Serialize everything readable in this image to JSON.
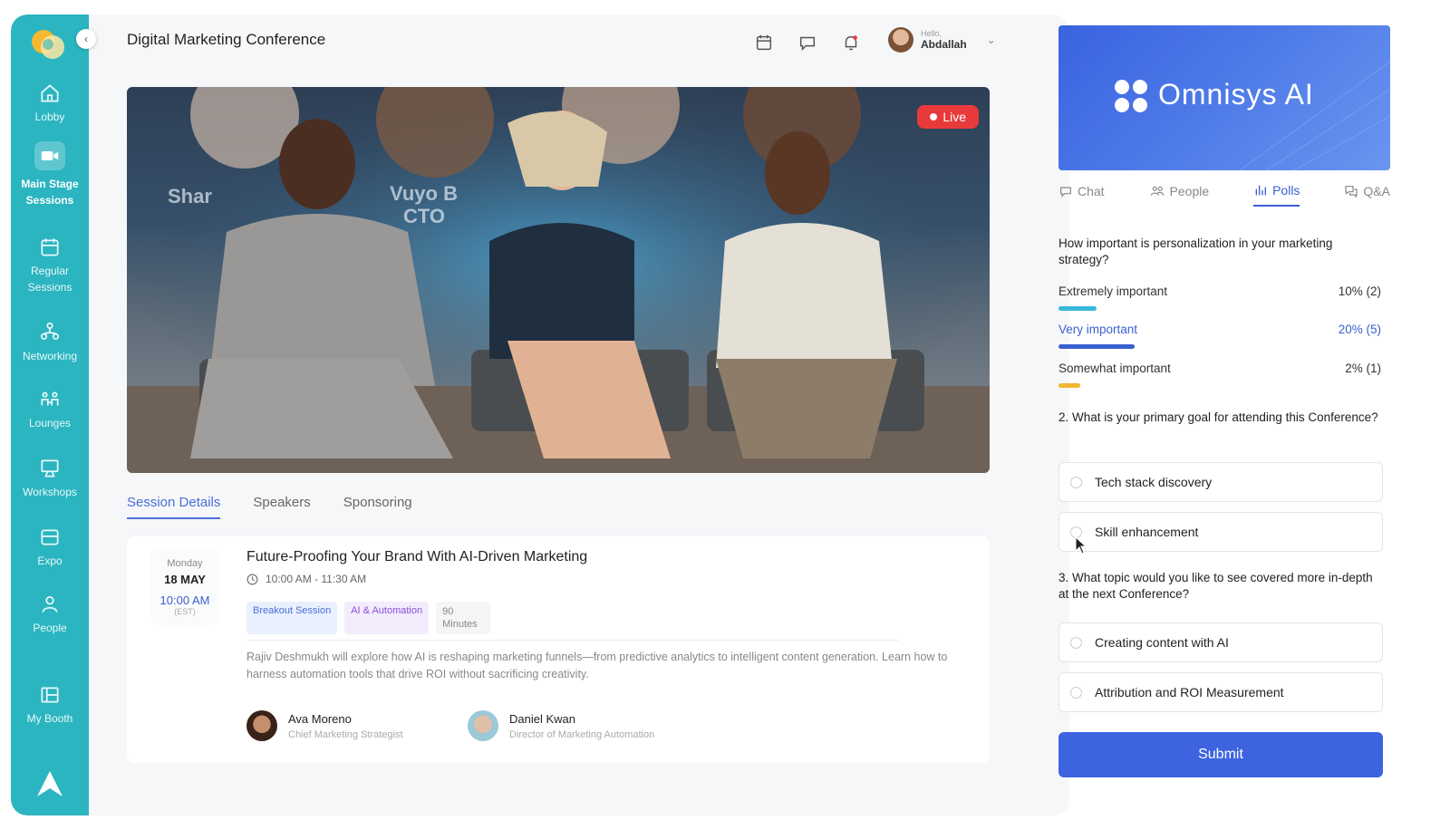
{
  "header": {
    "title": "Digital Marketing Conference",
    "user_greeting": "Hello,",
    "user_name": "Abdallah"
  },
  "sidebar": {
    "items": [
      {
        "label": "Lobby",
        "icon": "home-icon"
      },
      {
        "label": "Main Stage Sessions",
        "icon": "video-icon"
      },
      {
        "label": "Regular Sessions",
        "icon": "calendar-icon"
      },
      {
        "label": "Networking",
        "icon": "network-icon"
      },
      {
        "label": "Lounges",
        "icon": "lounge-icon"
      },
      {
        "label": "Workshops",
        "icon": "workshop-icon"
      },
      {
        "label": "Expo",
        "icon": "expo-icon"
      },
      {
        "label": "People",
        "icon": "people-icon"
      },
      {
        "label": "My Booth",
        "icon": "booth-icon"
      }
    ]
  },
  "video": {
    "live_label": "Live"
  },
  "session_tabs": [
    "Session Details",
    "Speakers",
    "Sponsoring"
  ],
  "session": {
    "day_of_week": "Monday",
    "date": "18 MAY",
    "start_time": "10:00 AM",
    "timezone": "(EST)",
    "title": "Future-Proofing Your Brand With AI-Driven Marketing",
    "time_range": "10:00 AM - 11:30 AM",
    "tags": [
      "Breakout Session",
      "AI & Automation"
    ],
    "duration": "90 Minutes",
    "description": "Rajiv Deshmukh will explore how AI is reshaping marketing funnels—from predictive analytics to intelligent content generation. Learn how to harness automation tools that drive ROI without sacrificing creativity.",
    "speakers": [
      {
        "name": "Ava Moreno",
        "role": "Chief Marketing Strategist"
      },
      {
        "name": "Daniel Kwan",
        "role": "Director of Marketing Automation"
      }
    ]
  },
  "panel": {
    "brand_name": "Omnisys AI",
    "tabs": [
      "Chat",
      "People",
      "Polls",
      "Q&A"
    ],
    "poll1": {
      "question": "How important is personalization in your marketing strategy?",
      "results": [
        {
          "label": "Extremely important",
          "value": "10% (2)",
          "color": "#3ab8dc",
          "fraction": 0.1
        },
        {
          "label": "Very important",
          "value": "20% (5)",
          "color": "#3a5fcf",
          "fraction": 0.2
        },
        {
          "label": "Somewhat important",
          "value": "2% (1)",
          "color": "#f2b630",
          "fraction": 0.02
        }
      ]
    },
    "poll2": {
      "question": "2. What is your primary goal for attending this Conference?",
      "options": [
        "Tech stack discovery",
        "Skill enhancement"
      ]
    },
    "poll3": {
      "question": "3. What topic would you like to see covered more in-depth at the next Conference?",
      "options": [
        "Creating content with AI",
        "Attribution and ROI Measurement"
      ]
    },
    "submit_label": "Submit"
  }
}
